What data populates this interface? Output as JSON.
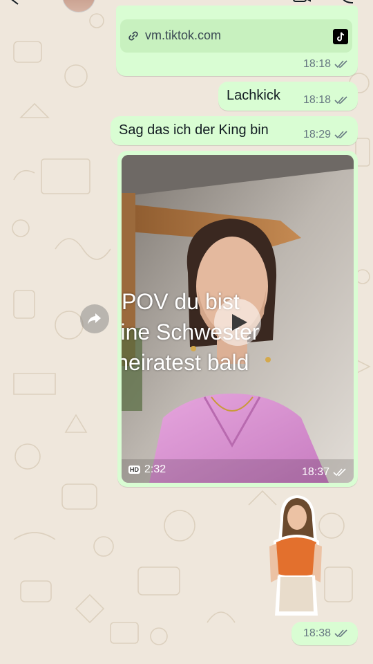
{
  "messages": {
    "link": {
      "url": "vm.tiktok.com",
      "time": "18:18",
      "icons": [
        "link-icon",
        "tiktok-logo-icon"
      ]
    },
    "lachkick": {
      "text": "Lachkick",
      "time": "18:18"
    },
    "king": {
      "text": "Sag das ich der King bin",
      "time": "18:29"
    },
    "video": {
      "caption_lines": [
        "POV du bist",
        "meine Schwester",
        "& heiratest bald"
      ],
      "quality_badge": "HD",
      "duration": "2:32",
      "time": "18:37"
    },
    "sticker": {
      "time": "18:38"
    }
  },
  "icons": {
    "read_receipt": "double-check-icon",
    "forward": "forward-arrow-icon",
    "play": "play-icon"
  },
  "colors": {
    "wallpaper": "#efe7dc",
    "outgoing_bubble": "#d9fdd3",
    "link_card": "#c8f1bf",
    "meta_text": "#667781",
    "read_tick": "#53bdeb"
  }
}
